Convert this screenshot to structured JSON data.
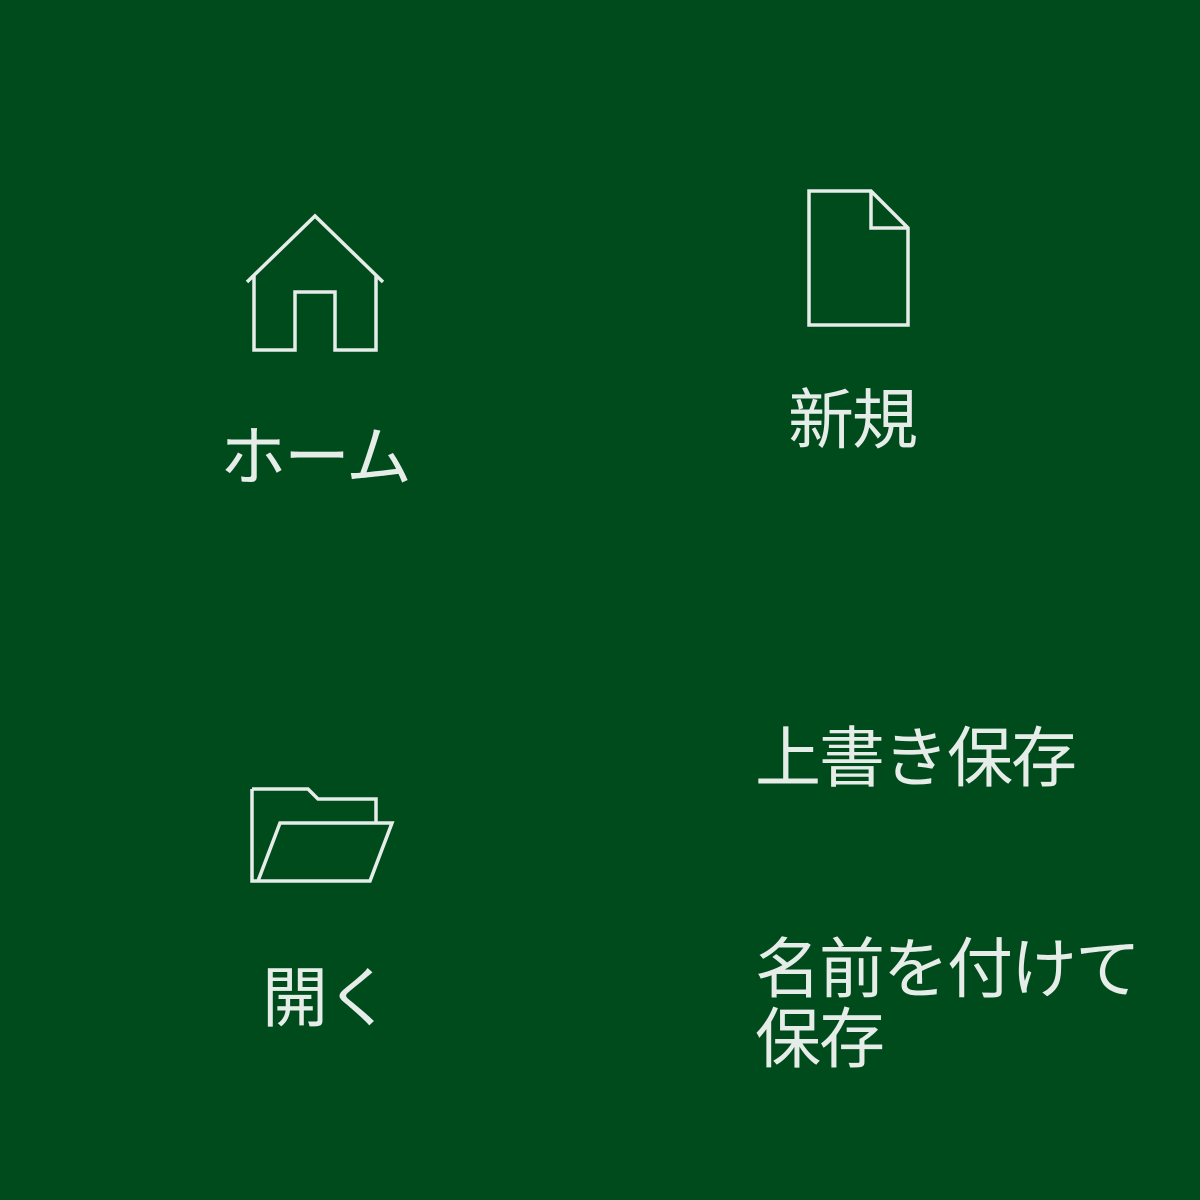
{
  "colors": {
    "background": "#004b1c",
    "foreground": "#e6ede8"
  },
  "menu": {
    "home": {
      "label": "ホーム",
      "icon": "home-icon"
    },
    "new": {
      "label": "新規",
      "icon": "new-document-icon"
    },
    "open": {
      "label": "開く",
      "icon": "open-folder-icon"
    },
    "save": {
      "label": "上書き保存"
    },
    "save_as": {
      "label": "名前を付けて保存"
    }
  }
}
